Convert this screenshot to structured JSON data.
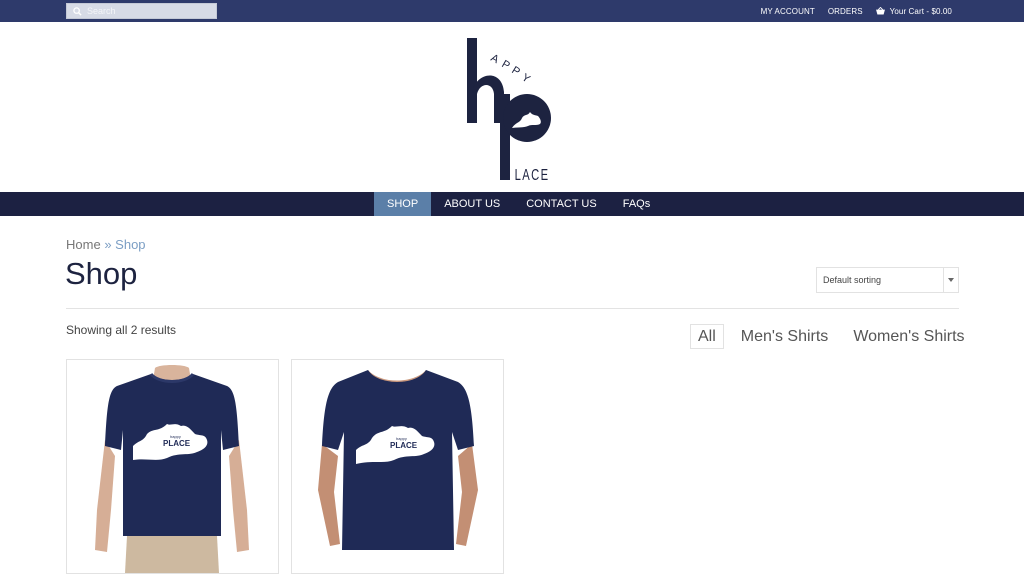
{
  "topbar": {
    "search_placeholder": "Search",
    "links": [
      "MY ACCOUNT",
      "ORDERS"
    ],
    "cart": "Your Cart - $0.00"
  },
  "logo": {
    "alt": "Happy Place",
    "letters_top": "APPY",
    "letters_bottom": "LACE"
  },
  "nav": {
    "items": [
      "SHOP",
      "ABOUT US",
      "CONTACT US",
      "FAQs"
    ],
    "active": "SHOP"
  },
  "breadcrumb": {
    "home": "Home",
    "sep": "»",
    "current": "Shop"
  },
  "page_title": "Shop",
  "sort": {
    "selected": "Default sorting"
  },
  "results_text": "Showing all 2 results",
  "filters": {
    "items": [
      "All",
      "Men's Shirts",
      "Women's Shirts"
    ],
    "active": "All"
  },
  "products": [
    {
      "kind": "men",
      "print_small": "happy",
      "print_big": "PLACE"
    },
    {
      "kind": "women",
      "print_small": "happy",
      "print_big": "PLACE"
    }
  ],
  "colors": {
    "topbar": "#2e3a6b",
    "nav": "#1c2142",
    "nav_active": "#5b7fa8",
    "brand_navy": "#1d2340",
    "shirt": "#1f2a56"
  }
}
